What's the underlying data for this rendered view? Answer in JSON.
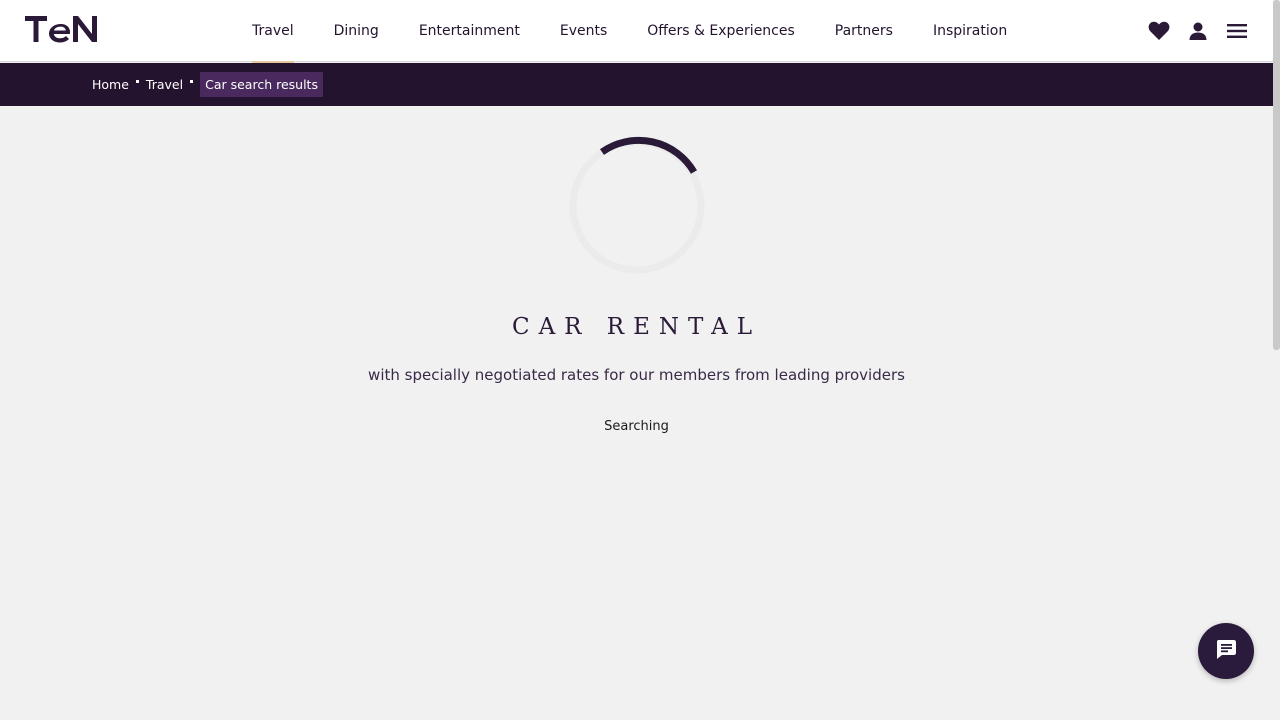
{
  "brand": {
    "logo_text": "TEN",
    "accent_color": "#24132f",
    "underline_color": "#e7c79a"
  },
  "nav": {
    "items": [
      {
        "label": "Travel",
        "active": true
      },
      {
        "label": "Dining",
        "active": false
      },
      {
        "label": "Entertainment",
        "active": false
      },
      {
        "label": "Events",
        "active": false
      },
      {
        "label": "Offers & Experiences",
        "active": false
      },
      {
        "label": "Partners",
        "active": false
      },
      {
        "label": "Inspiration",
        "active": false
      }
    ]
  },
  "header_icons": [
    "heart-icon",
    "user-icon",
    "menu-icon"
  ],
  "breadcrumb": {
    "items": [
      "Home",
      "Travel"
    ],
    "current": "Car search results"
  },
  "main": {
    "title": "CAR RENTAL",
    "subtitle": "with specially negotiated rates for our members from leading providers",
    "status": "Searching"
  },
  "chat": {
    "icon": "chat-icon"
  }
}
